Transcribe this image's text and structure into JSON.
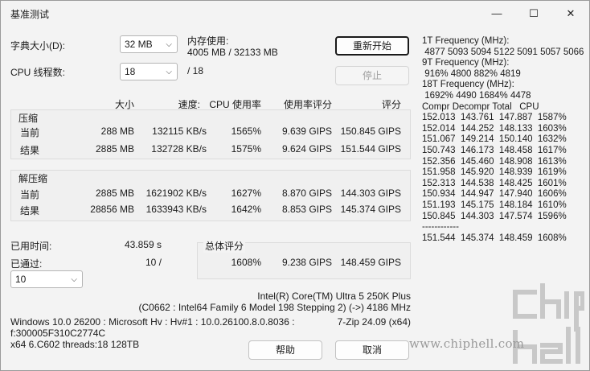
{
  "window": {
    "title": "基准测试",
    "min_icon": "—",
    "max_icon": "☐",
    "close_icon": "✕"
  },
  "settings": {
    "dict_label": "字典大小(D):",
    "dict_value": "32 MB",
    "threads_label": "CPU 线程数:",
    "threads_value": "18",
    "threads_max": "/ 18",
    "mem_label": "内存使用:",
    "mem_value": "4005 MB / 32133 MB",
    "restart_button": "重新开始",
    "stop_button": "停止"
  },
  "headers": {
    "size": "大小",
    "speed": "速度:",
    "cpu_usage": "CPU 使用率",
    "usage_rating": "使用率评分",
    "rating": "评分"
  },
  "compress": {
    "title": "压缩",
    "current": {
      "label": "当前",
      "size": "288 MB",
      "speed": "132115 KB/s",
      "cpu": "1565%",
      "usage": "9.639 GIPS",
      "rating": "150.845 GIPS"
    },
    "result": {
      "label": "结果",
      "size": "2885 MB",
      "speed": "132728 KB/s",
      "cpu": "1575%",
      "usage": "9.624 GIPS",
      "rating": "151.544 GIPS"
    }
  },
  "decompress": {
    "title": "解压缩",
    "current": {
      "label": "当前",
      "size": "2885 MB",
      "speed": "1621902 KB/s",
      "cpu": "1627%",
      "usage": "8.870 GIPS",
      "rating": "144.303 GIPS"
    },
    "result": {
      "label": "结果",
      "size": "28856 MB",
      "speed": "1633943 KB/s",
      "cpu": "1642%",
      "usage": "8.853 GIPS",
      "rating": "145.374 GIPS"
    }
  },
  "summary": {
    "elapsed_label": "已用时间:",
    "elapsed_value": "43.859 s",
    "passed_label": "已通过:",
    "passed_value": "10 /",
    "passes_value": "10",
    "total_label": "总体评分",
    "total_cpu": "1608%",
    "total_usage": "9.238 GIPS",
    "total_rating": "148.459 GIPS"
  },
  "cpu": {
    "name": "Intel(R) Core(TM) Ultra 5 250K Plus",
    "details": "(C0662 : Intel64 Family 6 Model 198 Stepping 2) (->) 4186 MHz"
  },
  "sysinfo": {
    "line1": "Windows 10.0 26200 : Microsoft Hv : Hv#1 : 10.0.26100.8.0.8036 :",
    "line2": "f:300005F310C2774C",
    "line3": "x64 6.C602 threads:18 128TB",
    "version": "7-Zip 24.09 (x64)"
  },
  "footer": {
    "help_button": "帮助",
    "cancel_button": "取消"
  },
  "freq": {
    "lines": [
      "1T Frequency (MHz):",
      " 4877 5093 5094 5122 5091 5057 5066",
      "9T Frequency (MHz):",
      " 916% 4800 882% 4819",
      "18T Frequency (MHz):",
      " 1692% 4490 1684% 4478",
      "Compr Decompr Total   CPU",
      "152.013  143.761  147.887  1587%",
      "152.014  144.252  148.133  1603%",
      "151.067  149.214  150.140  1632%",
      "150.743  146.173  148.458  1617%",
      "152.356  145.460  148.908  1613%",
      "151.958  145.920  148.939  1619%",
      "152.313  144.538  148.425  1601%",
      "150.934  144.947  147.940  1606%",
      "151.193  145.175  148.184  1610%",
      "150.845  144.303  147.574  1596%",
      "------------",
      "151.544  145.374  148.459  1608%"
    ]
  },
  "watermark": {
    "text": "www.chiphell.com",
    "logo": "chip hell"
  }
}
